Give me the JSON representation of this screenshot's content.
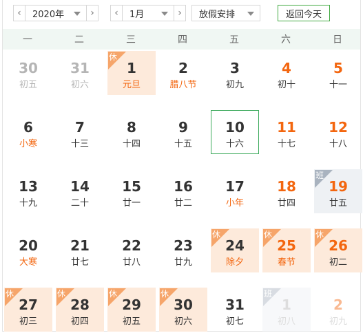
{
  "toolbar": {
    "year_value": "2020年",
    "month_value": "1月",
    "holiday_value": "放假安排",
    "today_label": "返回今天",
    "prev_symbol": "‹",
    "next_symbol": "›"
  },
  "weekdays": [
    "一",
    "二",
    "三",
    "四",
    "五",
    "六",
    "日"
  ],
  "tags": {
    "holiday": "休",
    "work": "班"
  },
  "days": [
    {
      "num": "30",
      "lunar": "初五",
      "muted": true
    },
    {
      "num": "31",
      "lunar": "初六",
      "muted": true
    },
    {
      "num": "1",
      "lunar": "元旦",
      "holiday": true,
      "festival": true
    },
    {
      "num": "2",
      "lunar": "腊八节",
      "festival": true
    },
    {
      "num": "3",
      "lunar": "初九"
    },
    {
      "num": "4",
      "lunar": "初十",
      "weekend": true
    },
    {
      "num": "5",
      "lunar": "十一",
      "weekend": true
    },
    {
      "num": "6",
      "lunar": "小寒",
      "festival": true
    },
    {
      "num": "7",
      "lunar": "十三"
    },
    {
      "num": "8",
      "lunar": "十四"
    },
    {
      "num": "9",
      "lunar": "十五"
    },
    {
      "num": "10",
      "lunar": "十六",
      "today": true
    },
    {
      "num": "11",
      "lunar": "十七",
      "weekend": true
    },
    {
      "num": "12",
      "lunar": "十八",
      "weekend": true
    },
    {
      "num": "13",
      "lunar": "十九"
    },
    {
      "num": "14",
      "lunar": "二十"
    },
    {
      "num": "15",
      "lunar": "廿一"
    },
    {
      "num": "16",
      "lunar": "廿二"
    },
    {
      "num": "17",
      "lunar": "小年",
      "festival": true
    },
    {
      "num": "18",
      "lunar": "廿四",
      "weekend": true
    },
    {
      "num": "19",
      "lunar": "廿五",
      "weekend": true,
      "workday": true
    },
    {
      "num": "20",
      "lunar": "大寒",
      "festival": true
    },
    {
      "num": "21",
      "lunar": "廿七"
    },
    {
      "num": "22",
      "lunar": "廿八"
    },
    {
      "num": "23",
      "lunar": "廿九"
    },
    {
      "num": "24",
      "lunar": "除夕",
      "holiday": true,
      "festival": true
    },
    {
      "num": "25",
      "lunar": "春节",
      "holiday": true,
      "festival": true,
      "weekend": true
    },
    {
      "num": "26",
      "lunar": "初二",
      "holiday": true,
      "weekend": true
    },
    {
      "num": "27",
      "lunar": "初三",
      "holiday": true
    },
    {
      "num": "28",
      "lunar": "初四",
      "holiday": true
    },
    {
      "num": "29",
      "lunar": "初五",
      "holiday": true
    },
    {
      "num": "30",
      "lunar": "初六",
      "holiday": true
    },
    {
      "num": "31",
      "lunar": "初七"
    },
    {
      "num": "1",
      "lunar": "初八",
      "muted": true,
      "workday": true,
      "fade": true
    },
    {
      "num": "2",
      "lunar": "初九",
      "muted": true,
      "weekend": true,
      "fade": true
    }
  ],
  "colors": {
    "accent_orange": "#f3660f",
    "holiday_bg": "#fdeadb",
    "today_border": "#3aa95a",
    "weekday_bar": "#f0f7f3"
  }
}
